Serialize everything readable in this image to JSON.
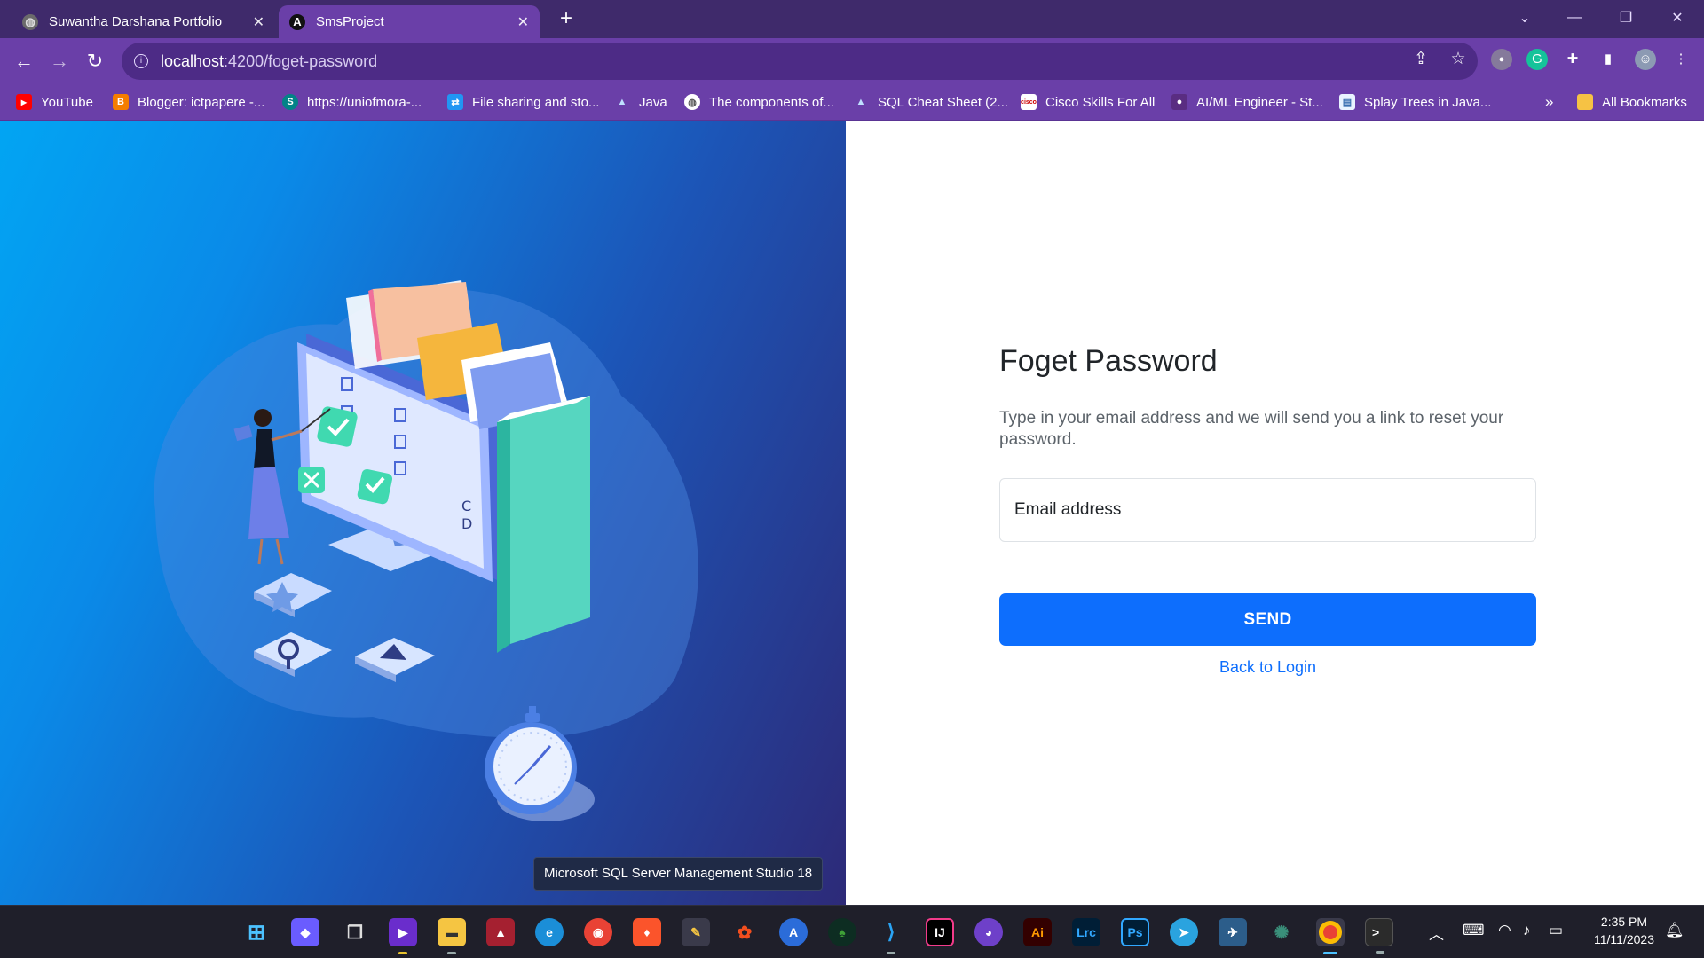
{
  "browser": {
    "tabs": [
      {
        "title": "Suwantha Darshana Portfolio",
        "icon": "globe-icon"
      },
      {
        "title": "SmsProject",
        "icon": "angular-icon"
      }
    ],
    "address": {
      "host": "localhost",
      "path": ":4200/foget-password"
    },
    "bookmarks": [
      {
        "label": "YouTube",
        "icon": "youtube-icon",
        "color": "#ff0000"
      },
      {
        "label": "Blogger: ictpapere -...",
        "icon": "blogger-icon",
        "color": "#f57d00"
      },
      {
        "label": "https://uniofmora-...",
        "icon": "sharepoint-icon",
        "color": "#038387"
      },
      {
        "label": "File sharing and sto...",
        "icon": "file-share-icon",
        "color": "#2196f3"
      },
      {
        "label": "Java",
        "icon": "mountain-icon",
        "color": "#8fb8e0"
      },
      {
        "label": "The components of...",
        "icon": "globe-icon",
        "color": "#6c6c6c"
      },
      {
        "label": "SQL Cheat Sheet (2...",
        "icon": "mountain-icon",
        "color": "#8fb8e0"
      },
      {
        "label": "Cisco Skills For All",
        "icon": "cisco-icon",
        "color": "#ffffff"
      },
      {
        "label": "AI/ML Engineer - St...",
        "icon": "ai-icon",
        "color": "#5a2d82"
      },
      {
        "label": "Splay Trees in Java...",
        "icon": "doc-icon",
        "color": "#e9f3ff"
      }
    ],
    "all_bookmarks": "All Bookmarks",
    "overflow": "»"
  },
  "page": {
    "heading": "Foget Password",
    "description": "Type in your email address and we will send you a link to reset your password.",
    "email_placeholder": "Email address",
    "send_label": "SEND",
    "back_label": "Back to Login",
    "tooltip": "Microsoft SQL Server Management Studio 18",
    "accent": "#0d6efd"
  },
  "taskbar": {
    "time": "2:35 PM",
    "date": "11/11/2023"
  }
}
